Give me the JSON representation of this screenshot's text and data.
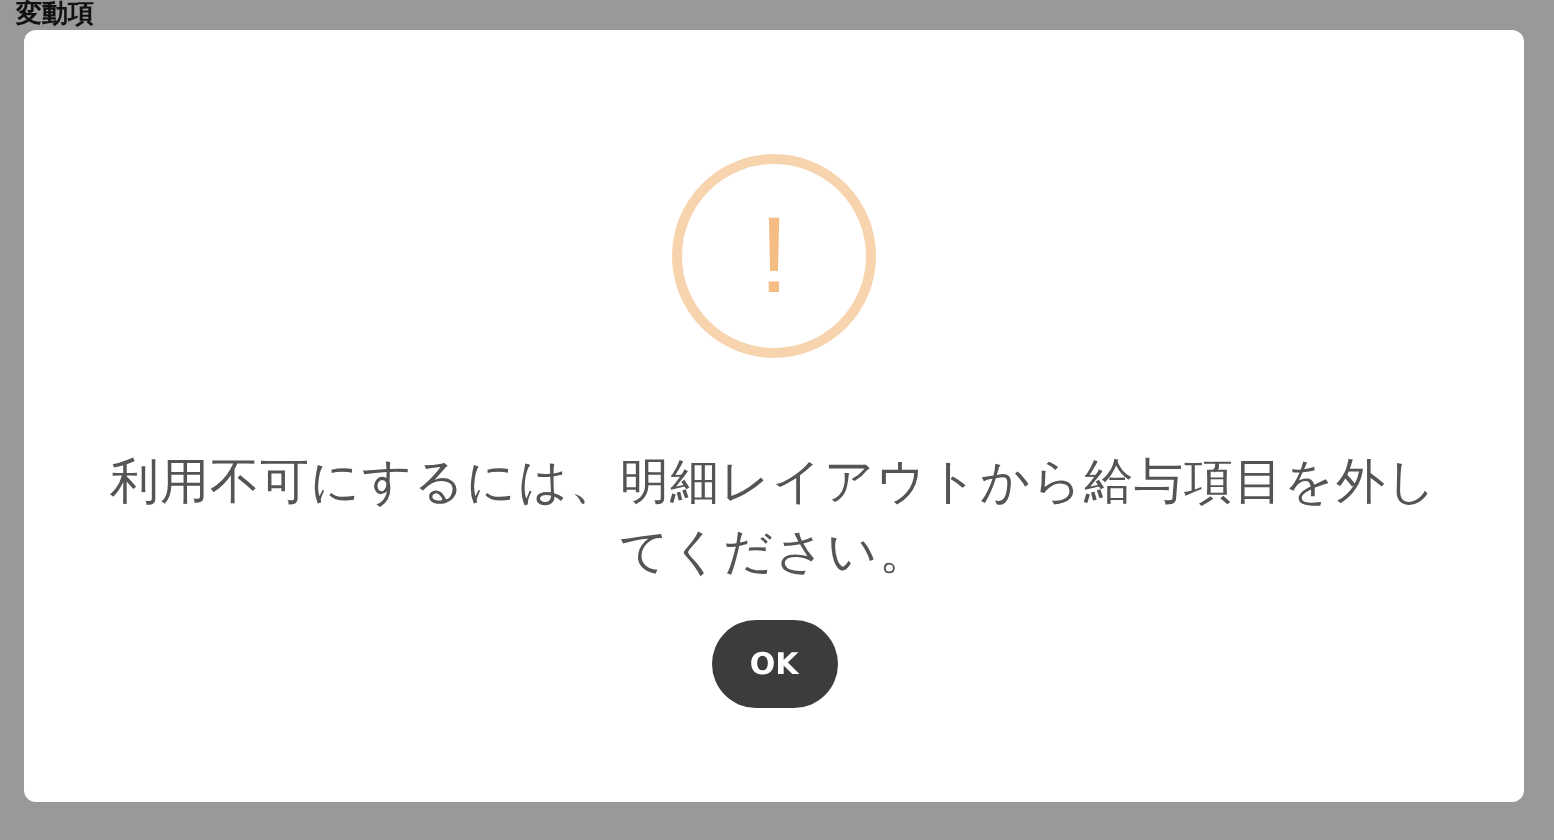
{
  "page": {
    "heading": "変動項"
  },
  "dialog": {
    "icon": "!",
    "message": "利用不可にするには、明細レイアウトから給与項目を外してください。",
    "buttons": [
      "OK"
    ]
  }
}
